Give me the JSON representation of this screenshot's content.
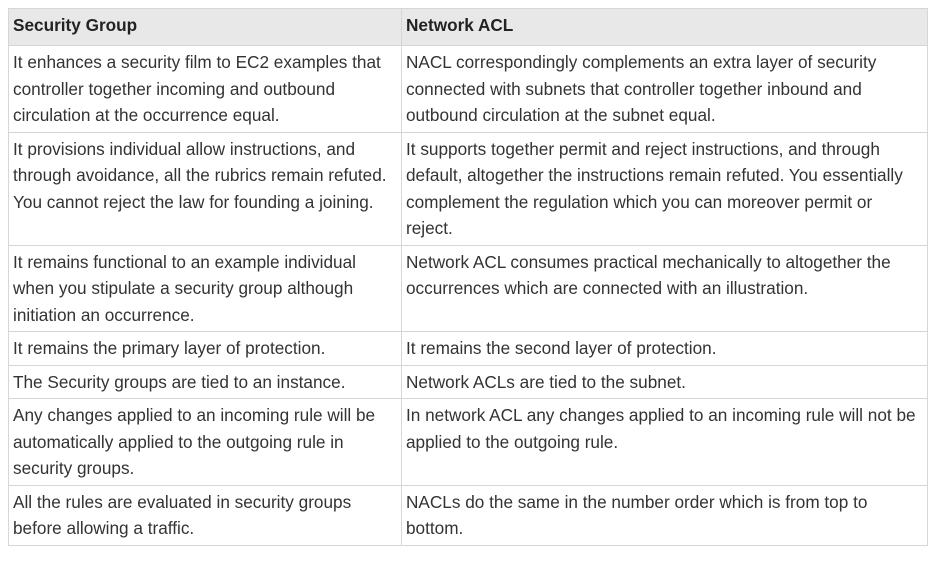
{
  "table": {
    "headers": [
      "Security Group",
      "Network ACL"
    ],
    "rows": [
      [
        "It enhances a security film to EC2 examples that controller together incoming and outbound circulation at the occurrence equal.",
        "NACL correspondingly complements an extra layer of security connected with subnets that controller together inbound and outbound circulation at the subnet equal."
      ],
      [
        "It provisions individual allow instructions, and through avoidance, all the rubrics remain refuted. You cannot reject the law for founding a joining.",
        "It supports together permit and reject instructions, and through default, altogether the instructions remain refuted. You essentially complement the regulation which you can moreover permit or reject."
      ],
      [
        "It remains functional to an example individual when you stipulate a security group although initiation an occurrence.",
        "Network ACL consumes practical mechanically to altogether the occurrences which are connected with an illustration."
      ],
      [
        "It remains the primary layer of protection.",
        "It remains the second layer of protection."
      ],
      [
        "The Security groups are tied to an instance.",
        "Network ACLs are tied to the subnet."
      ],
      [
        "Any changes applied to an incoming rule will be automatically applied to the outgoing rule in security groups.",
        "In network ACL any changes applied to an incoming rule will not be applied to the outgoing rule."
      ],
      [
        "All the rules are evaluated in security groups before allowing a traffic.",
        "NACLs do the same in the number order which is from top to bottom."
      ]
    ]
  }
}
